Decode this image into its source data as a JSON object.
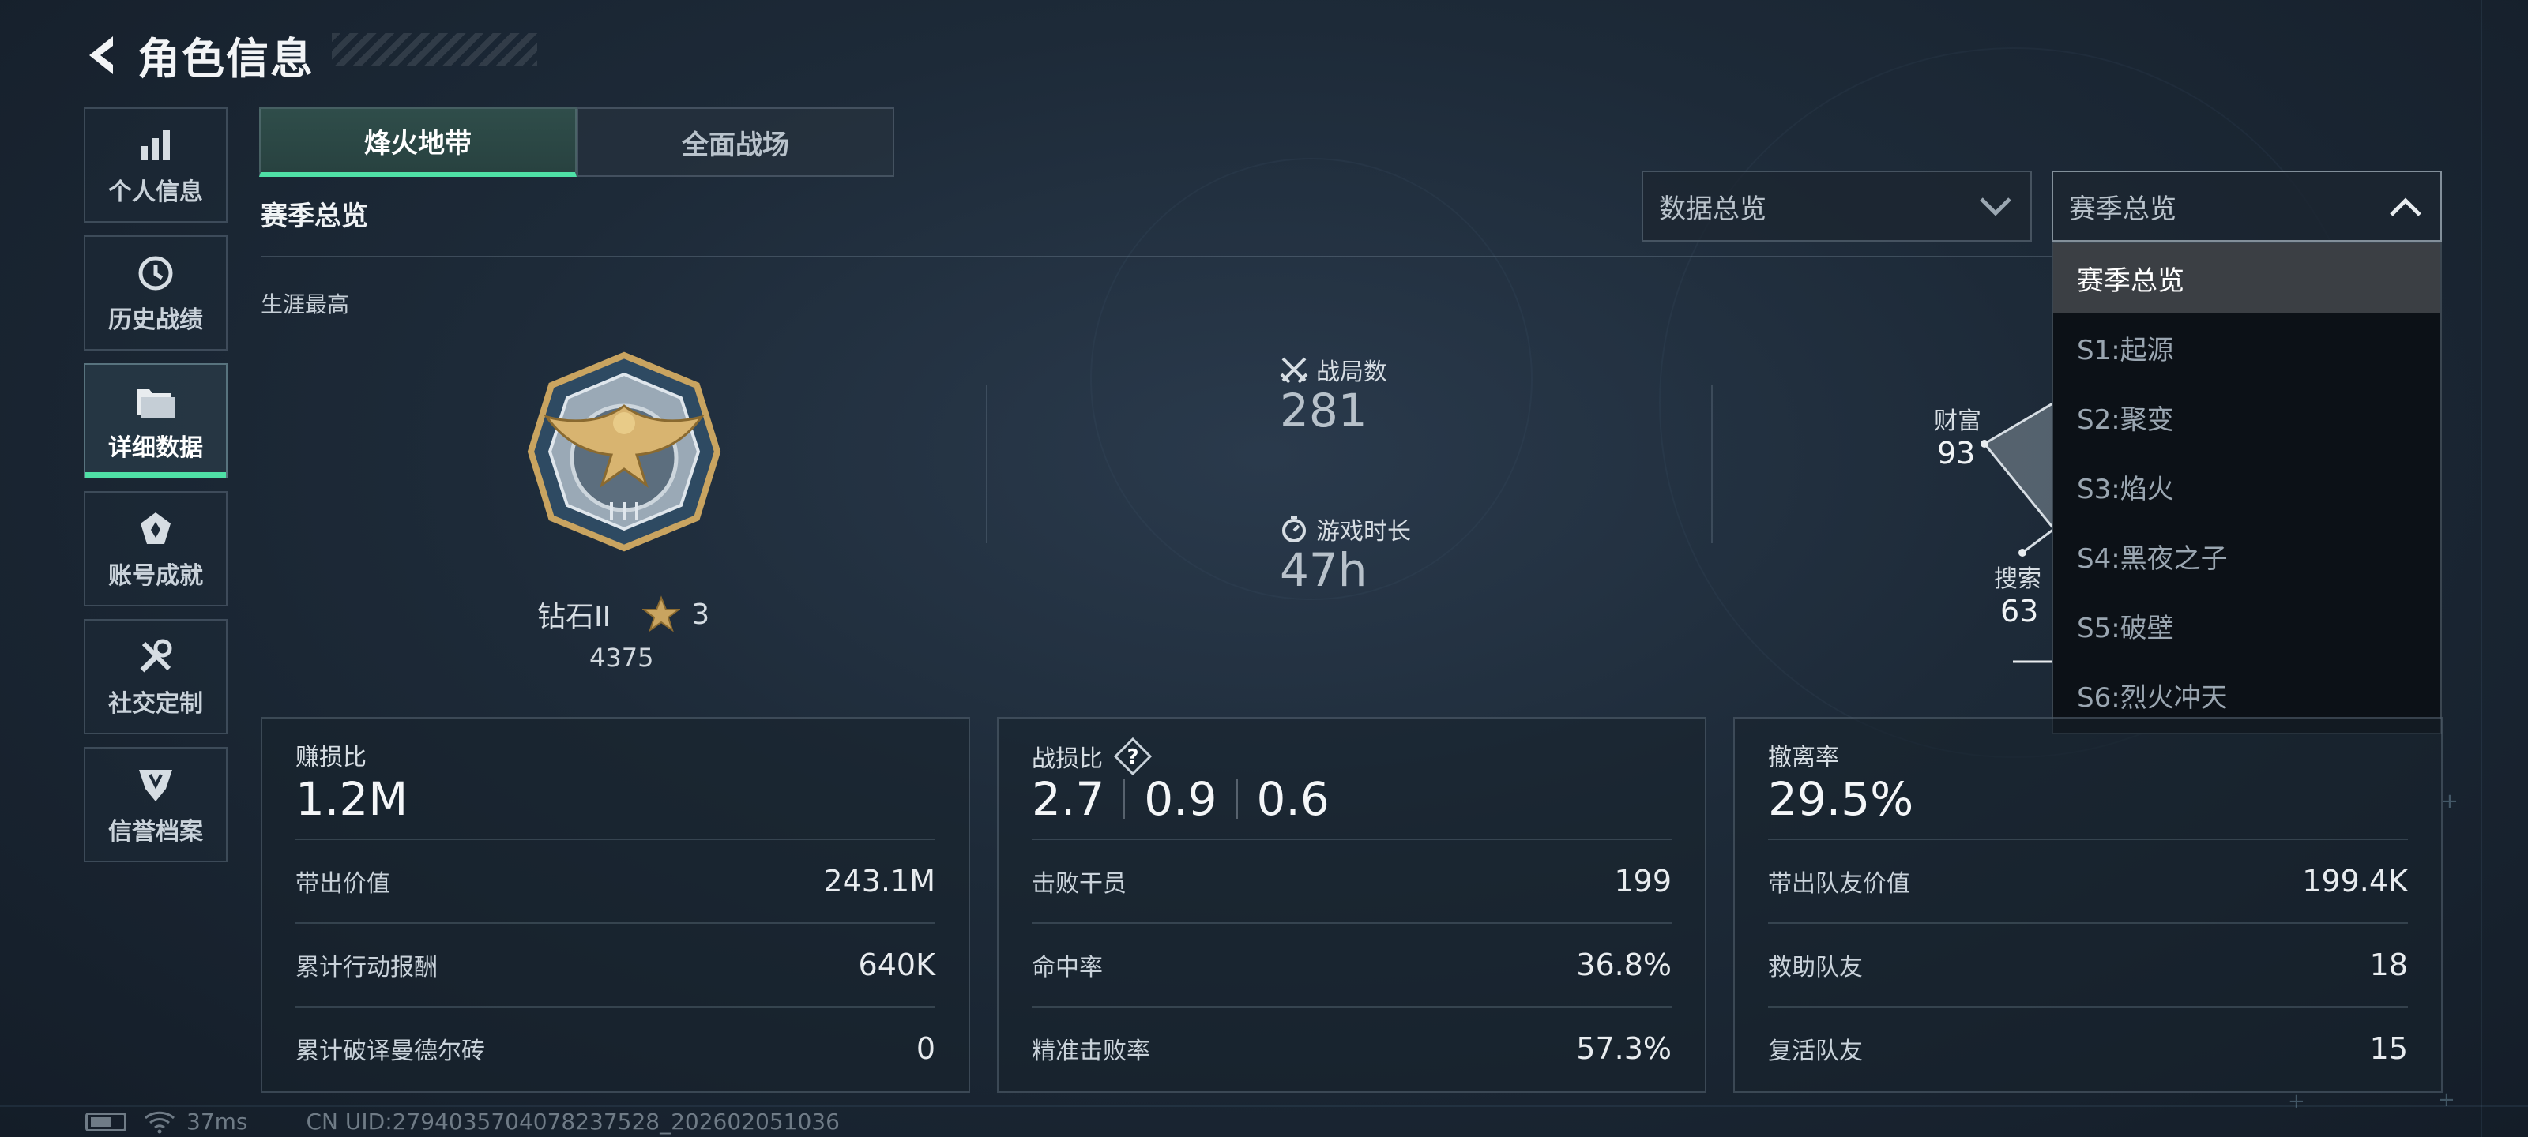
{
  "header": {
    "title": "角色信息"
  },
  "sidebar": {
    "items": [
      {
        "label": "个人信息",
        "icon": "bar-chart-icon"
      },
      {
        "label": "历史战绩",
        "icon": "history-clock-icon"
      },
      {
        "label": "详细数据",
        "icon": "folder-icon",
        "active": true
      },
      {
        "label": "账号成就",
        "icon": "achievement-icon"
      },
      {
        "label": "社交定制",
        "icon": "wrench-icon"
      },
      {
        "label": "信誉档案",
        "icon": "shield-emblem-icon"
      }
    ]
  },
  "mode_tabs": {
    "tab1": "烽火地带",
    "tab2": "全面战场",
    "active": "烽火地带"
  },
  "section_title": "赛季总览",
  "filters": {
    "data_select": "数据总览",
    "season_select": "赛季总览",
    "season_options": [
      "赛季总览",
      "S1:起源",
      "S2:聚变",
      "S3:焰火",
      "S4:黑夜之子",
      "S5:破壁",
      "S6:烈火冲天"
    ]
  },
  "career": {
    "label": "生涯最高",
    "rank_name": "钻石II",
    "stars": "3",
    "score": "4375"
  },
  "stats": {
    "matches_label": "战局数",
    "matches_value": "281",
    "playtime_label": "游戏时长",
    "playtime_value": "47h"
  },
  "radar": {
    "wealth_label": "财富",
    "wealth_value": "93",
    "search_label": "搜索",
    "search_value": "63"
  },
  "cards": {
    "profit": {
      "title": "赚损比",
      "big": "1.2M",
      "rows": [
        {
          "label": "带出价值",
          "value": "243.1M"
        },
        {
          "label": "累计行动报酬",
          "value": "640K"
        },
        {
          "label": "累计破译曼德尔砖",
          "value": "0"
        }
      ]
    },
    "combat": {
      "title": "战损比",
      "help": "?",
      "big_values": [
        "2.7",
        "0.9",
        "0.6"
      ],
      "rows": [
        {
          "label": "击败干员",
          "value": "199"
        },
        {
          "label": "命中率",
          "value": "36.8%"
        },
        {
          "label": "精准击败率",
          "value": "57.3%"
        }
      ]
    },
    "extract": {
      "title": "撤离率",
      "big": "29.5%",
      "rows": [
        {
          "label": "带出队友价值",
          "value": "199.4K"
        },
        {
          "label": "救助队友",
          "value": "18"
        },
        {
          "label": "复活队友",
          "value": "15"
        }
      ]
    }
  },
  "footer": {
    "ping": "37ms",
    "uid": "CN UID:2794035704078237528_202602051036"
  },
  "colors": {
    "accent": "#4fe0a6",
    "background": "#1d2a38"
  }
}
